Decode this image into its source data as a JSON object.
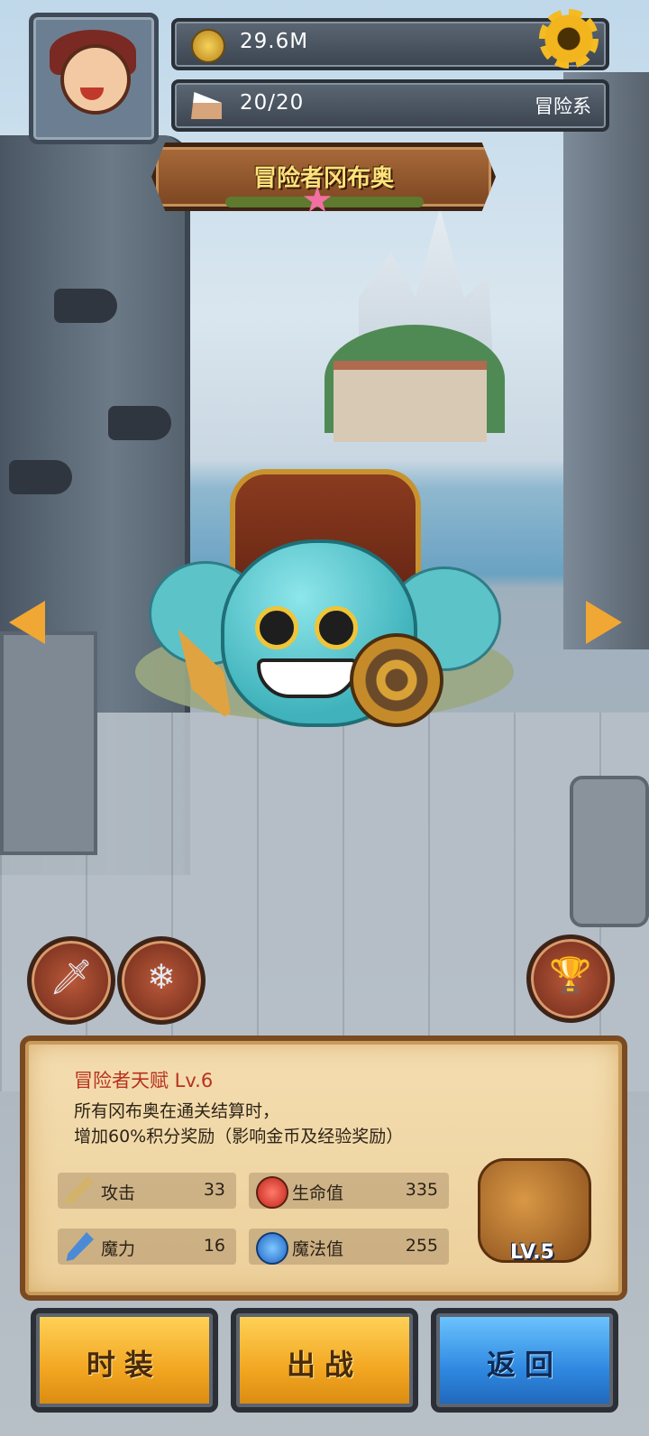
{
  "hud": {
    "gold": "29.6M",
    "stamina": "20/20",
    "category_tag": "冒险系",
    "gold_icon": "coin-icon",
    "stamina_icon": "cake-icon",
    "settings_icon": "gear-icon"
  },
  "character": {
    "name": "冒险者冈布奥"
  },
  "side_buttons": {
    "left_1": "dagger-icon",
    "left_2": "ice-map-icon",
    "right_1": "golden-trophy-icon"
  },
  "talent": {
    "title": "冒险者天赋 Lv.6",
    "description": "所有冈布奥在通关结算时，\n增加60%积分奖励（影响金币及经验奖励）"
  },
  "stats": [
    {
      "label": "攻击",
      "value": "33",
      "icon": "sword-icon"
    },
    {
      "label": "生命值",
      "value": "335",
      "icon": "red-potion-icon"
    },
    {
      "label": "魔力",
      "value": "16",
      "icon": "staff-icon"
    },
    {
      "label": "魔法值",
      "value": "255",
      "icon": "blue-potion-icon"
    }
  ],
  "equipment": {
    "level": "LV.5",
    "icon": "adventurer-bag-icon"
  },
  "buttons": {
    "costume": "时装",
    "deploy": "出战",
    "back": "返回"
  },
  "colors": {
    "gold_button": "#f2a621",
    "blue_button": "#2f88e0",
    "talent_title": "#b7321f",
    "title_text": "#ffe27a"
  }
}
